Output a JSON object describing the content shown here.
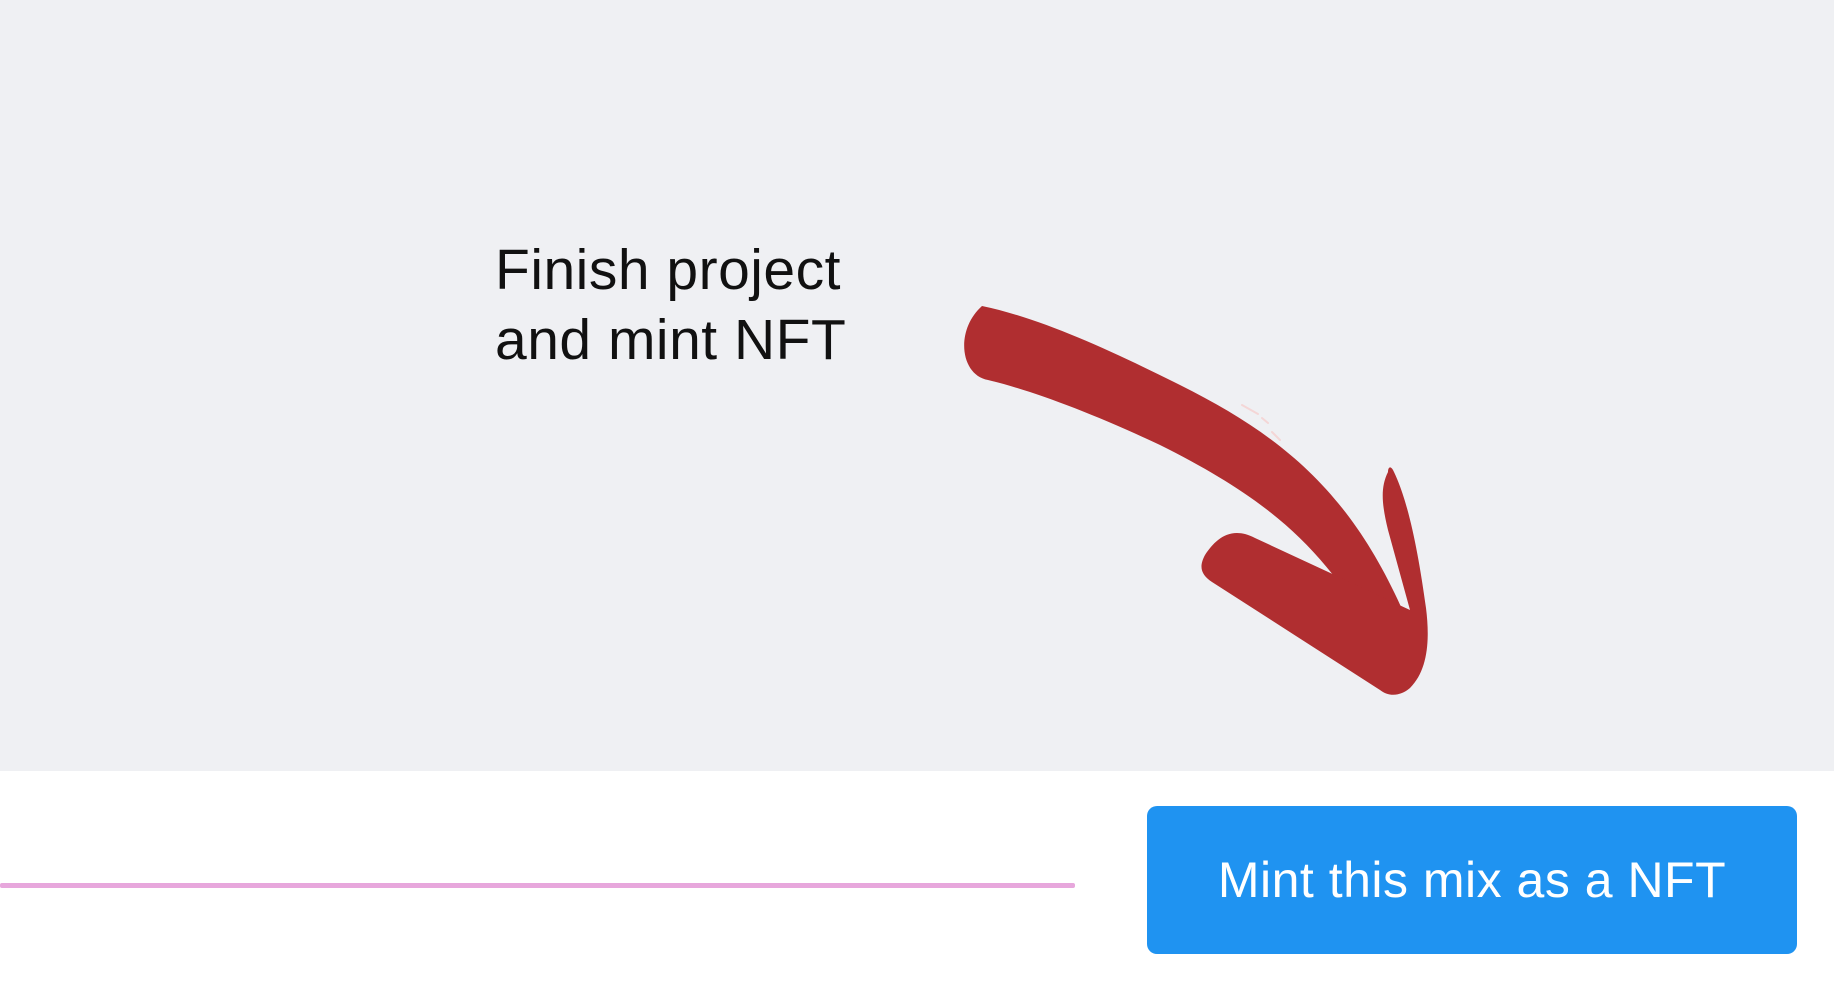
{
  "annotation": {
    "line1": "Finish project",
    "line2": "and mint NFT",
    "arrow_color": "#b02e30",
    "arrow_icon": "curved-arrow-down-right-icon"
  },
  "footer": {
    "mint_button_label": "Mint this mix as a NFT",
    "button_color": "#1f93f1",
    "progress_color": "#e7a7dc"
  },
  "colors": {
    "canvas_background": "#eff0f3",
    "bar_background": "#ffffff"
  }
}
